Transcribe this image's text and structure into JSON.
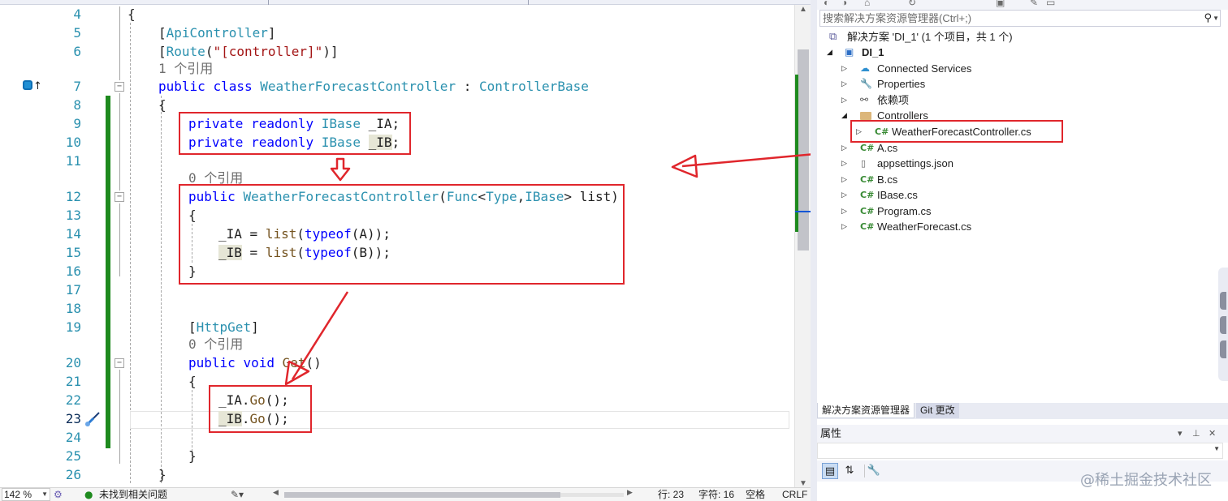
{
  "editor": {
    "line_numbers": [
      "4",
      "5",
      "6",
      "7",
      "8",
      "9",
      "10",
      "11",
      "12",
      "13",
      "14",
      "15",
      "16",
      "17",
      "18",
      "19",
      "20",
      "21",
      "22",
      "23",
      "24",
      "25",
      "26"
    ],
    "codelens": {
      "one_ref": "1 个引用",
      "zero_ref_ctor": "0 个引用",
      "zero_ref_get": "0 个引用"
    },
    "code": {
      "l4_brace": "{",
      "l5_bracket_open": "[",
      "l5_attr": "ApiController",
      "l5_bracket_close": "]",
      "l6_bracket_open": "[",
      "l6_attr": "Route",
      "l6_paren_open": "(",
      "l6_string": "\"[controller]\"",
      "l6_close": ")]",
      "l7_kw1": "public",
      "l7_kw2": "class",
      "l7_name": "WeatherForecastController",
      "l7_colon": " : ",
      "l7_base": "ControllerBase",
      "l8_brace": "{",
      "l9_kw1": "private",
      "l9_kw2": "readonly",
      "l9_type": "IBase",
      "l9_field": "_IA;",
      "l10_kw1": "private",
      "l10_kw2": "readonly",
      "l10_type": "IBase",
      "l10_field": "_IB",
      "l10_semi": ";",
      "l12_kw": "public",
      "l12_name": "WeatherForecastController",
      "l12_p1": "(",
      "l12_func": "Func",
      "l12_lt": "<",
      "l12_t1": "Type",
      "l12_comma": ",",
      "l12_t2": "IBase",
      "l12_gt": ">",
      "l12_rest": " list)",
      "l13_brace": "{",
      "l14_var": "_IA",
      "l14_eq": " = ",
      "l14_list": "list",
      "l14_p1": "(",
      "l14_typeof": "typeof",
      "l14_arg": "(A));",
      "l15_var": "_IB",
      "l15_eq": " = ",
      "l15_list": "list",
      "l15_p1": "(",
      "l15_typeof": "typeof",
      "l15_arg": "(B));",
      "l16_brace": "}",
      "l19_bracket_open": "[",
      "l19_attr": "HttpGet",
      "l19_bracket_close": "]",
      "l20_kw1": "public",
      "l20_kw2": "void",
      "l20_name": "Get",
      "l20_parens": "()",
      "l21_brace": "{",
      "l22_var": "_IA.",
      "l22_meth": "Go",
      "l22_rest": "();",
      "l23_var": "_IB",
      "l23_dot": ".",
      "l23_meth": "Go",
      "l23_rest": "();",
      "l25_brace": "}",
      "l26_brace": "}"
    }
  },
  "statusbar": {
    "zoom": "142 %",
    "issues": "未找到相关问题",
    "line": "行: 23",
    "col": "字符: 16",
    "spaces": "空格",
    "eol": "CRLF"
  },
  "solution_explorer": {
    "search_placeholder": "搜索解决方案资源管理器(Ctrl+;)",
    "solution_label": "解决方案 'DI_1' (1 个项目，共 1 个)",
    "project_label": "DI_1",
    "items": [
      {
        "label": "Connected Services",
        "icon": "connected-services-icon"
      },
      {
        "label": "Properties",
        "icon": "wrench-icon"
      },
      {
        "label": "依赖项",
        "icon": "dependencies-icon"
      },
      {
        "label": "Controllers",
        "icon": "folder-icon"
      },
      {
        "label": "WeatherForecastController.cs",
        "icon": "csharp-file-icon"
      },
      {
        "label": "A.cs",
        "icon": "csharp-file-icon"
      },
      {
        "label": "appsettings.json",
        "icon": "json-file-icon"
      },
      {
        "label": "B.cs",
        "icon": "csharp-file-icon"
      },
      {
        "label": "IBase.cs",
        "icon": "csharp-file-icon"
      },
      {
        "label": "Program.cs",
        "icon": "csharp-file-icon"
      },
      {
        "label": "WeatherForecast.cs",
        "icon": "csharp-file-icon"
      }
    ],
    "cs_glyph": "C#",
    "tabs": [
      "解决方案资源管理器",
      "Git 更改"
    ]
  },
  "properties": {
    "title": "属性"
  },
  "watermark": "@稀土掘金技术社区",
  "colors": {
    "annotation_red": "#e0262c",
    "change_bar_green": "#1e8a1e",
    "keyword_blue": "#0000ff",
    "type_teal": "#2b91af",
    "string_red": "#a31515"
  }
}
